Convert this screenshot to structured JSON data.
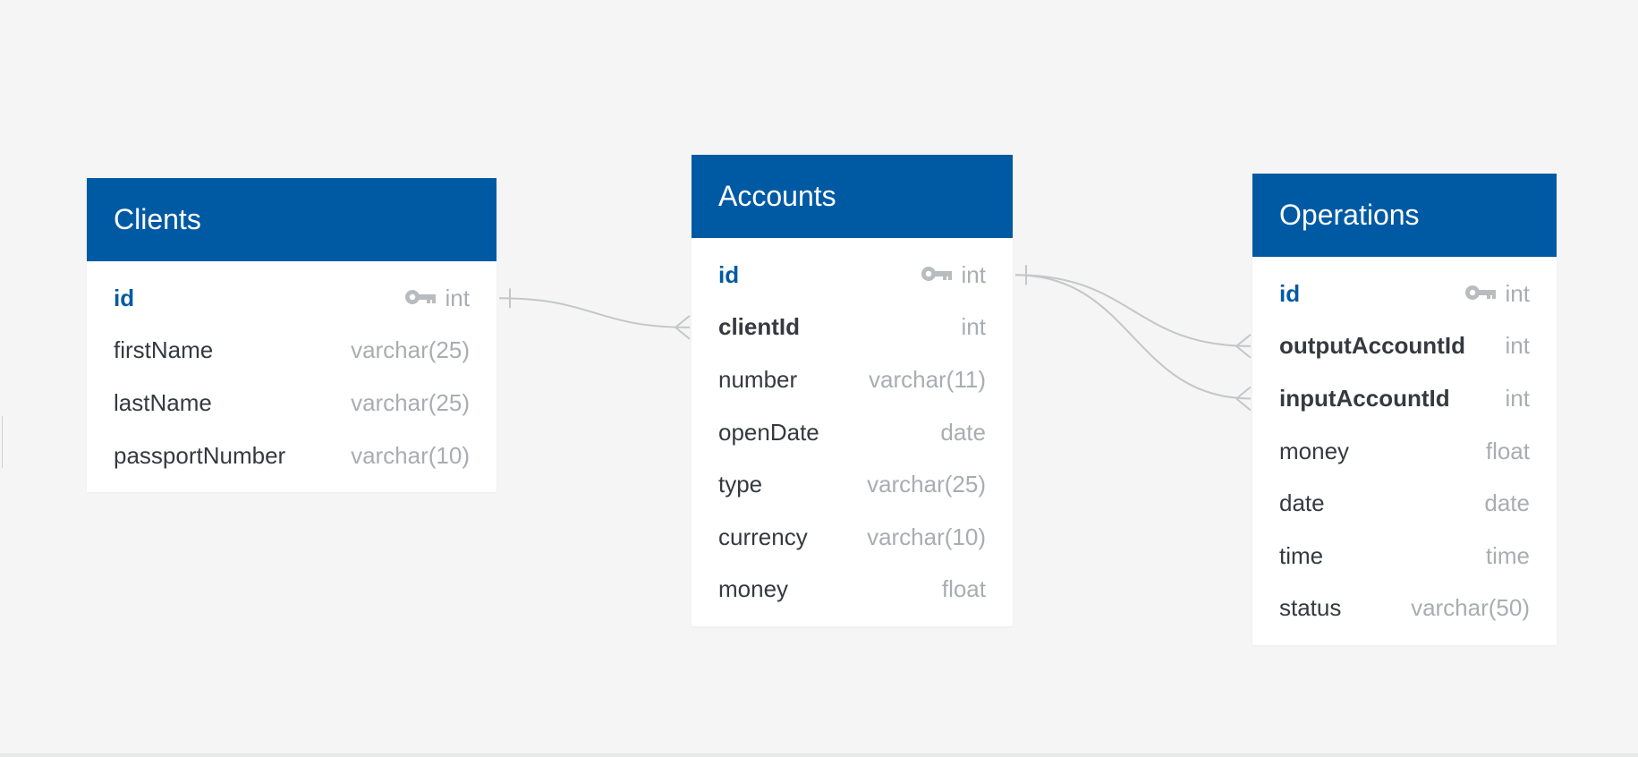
{
  "colors": {
    "header": "#005aa3",
    "background": "#f4f5f4",
    "row_text": "#343a40",
    "type_text": "#a9adb1",
    "pk_text": "#005aa3",
    "connector": "#c4c6c8"
  },
  "tables": [
    {
      "title": "Clients",
      "columns": [
        {
          "name": "id",
          "type": "int",
          "role": "pk",
          "icon": "key-icon"
        },
        {
          "name": "firstName",
          "type": "varchar(25)",
          "role": ""
        },
        {
          "name": "lastName",
          "type": "varchar(25)",
          "role": ""
        },
        {
          "name": "passportNumber",
          "type": "varchar(10)",
          "role": ""
        }
      ]
    },
    {
      "title": "Accounts",
      "columns": [
        {
          "name": "id",
          "type": "int",
          "role": "pk",
          "icon": "key-icon"
        },
        {
          "name": "clientId",
          "type": "int",
          "role": "fk"
        },
        {
          "name": "number",
          "type": "varchar(11)",
          "role": ""
        },
        {
          "name": "openDate",
          "type": "date",
          "role": ""
        },
        {
          "name": "type",
          "type": "varchar(25)",
          "role": ""
        },
        {
          "name": "currency",
          "type": "varchar(10)",
          "role": ""
        },
        {
          "name": "money",
          "type": "float",
          "role": ""
        }
      ]
    },
    {
      "title": "Operations",
      "columns": [
        {
          "name": "id",
          "type": "int",
          "role": "pk",
          "icon": "key-icon"
        },
        {
          "name": "outputAccountId",
          "type": "int",
          "role": "fk"
        },
        {
          "name": "inputAccountId",
          "type": "int",
          "role": "fk"
        },
        {
          "name": "money",
          "type": "float",
          "role": ""
        },
        {
          "name": "date",
          "type": "date",
          "role": ""
        },
        {
          "name": "time",
          "type": "time",
          "role": ""
        },
        {
          "name": "status",
          "type": "varchar(50)",
          "role": ""
        }
      ]
    }
  ],
  "relations": [
    {
      "from": "Clients.id",
      "to": "Accounts.clientId",
      "cardinality": "one-to-many"
    },
    {
      "from": "Accounts.id",
      "to": "Operations.outputAccountId",
      "cardinality": "one-to-many"
    },
    {
      "from": "Accounts.id",
      "to": "Operations.inputAccountId",
      "cardinality": "one-to-many"
    }
  ]
}
